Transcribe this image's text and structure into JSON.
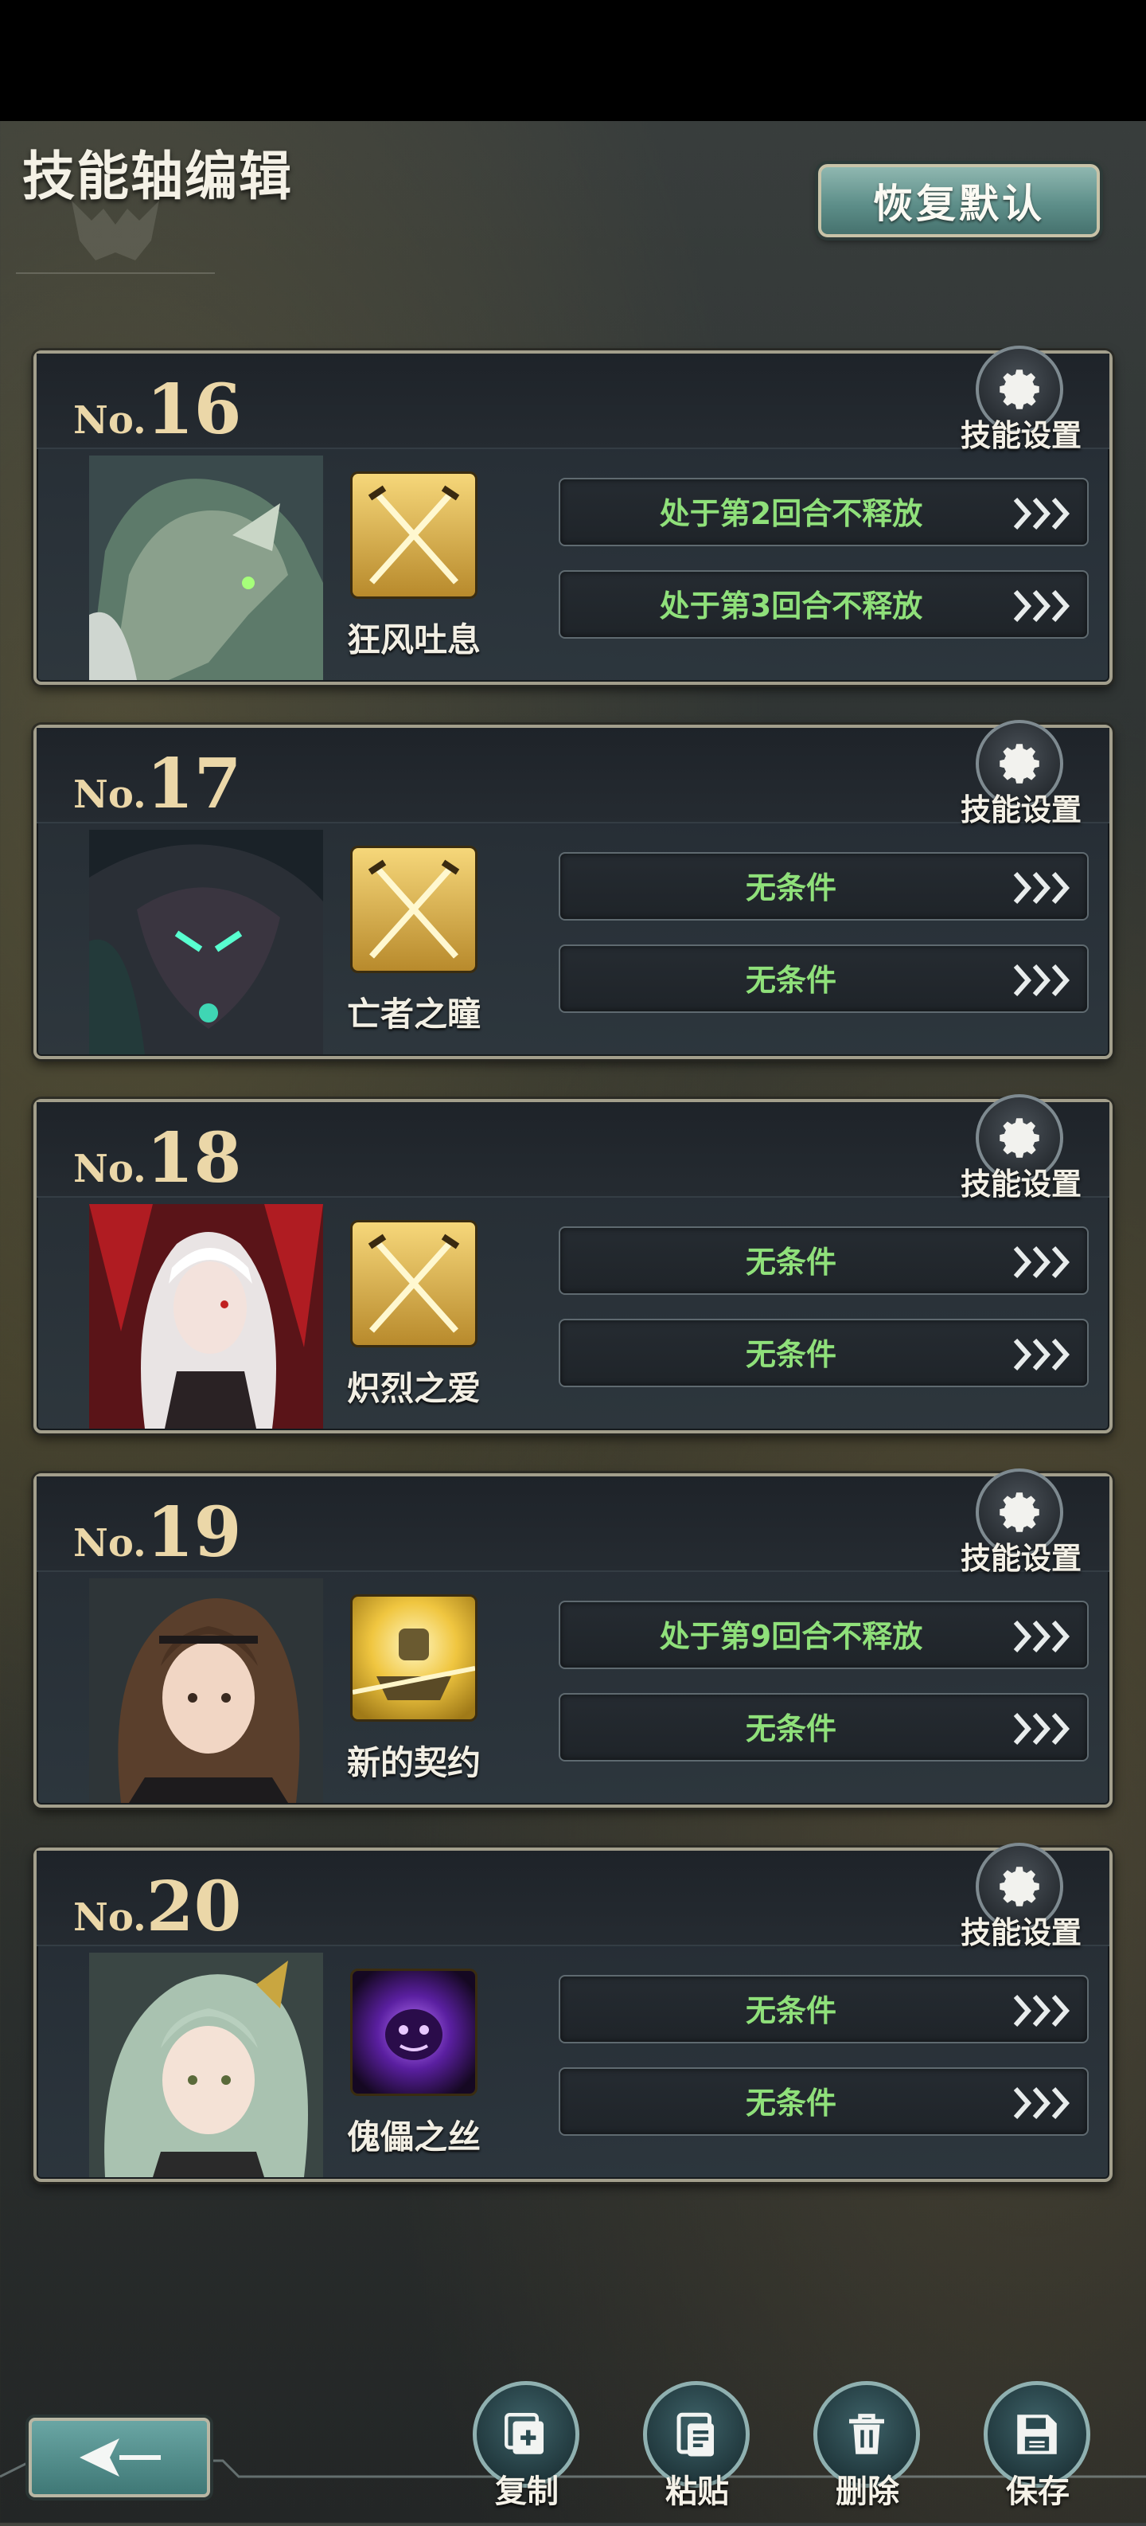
{
  "header": {
    "title": "技能轴编辑",
    "restore_button": "恢复默认"
  },
  "cards": [
    {
      "no_prefix": "No.",
      "no": "16",
      "settings_label": "技能设置",
      "skill_name": "狂风吐息",
      "skill_icon": "crossed-swords-icon",
      "conditions": [
        "处于第2回合不释放",
        "处于第3回合不释放"
      ]
    },
    {
      "no_prefix": "No.",
      "no": "17",
      "settings_label": "技能设置",
      "skill_name": "亡者之瞳",
      "skill_icon": "crossed-swords-icon",
      "conditions": [
        "无条件",
        "无条件"
      ]
    },
    {
      "no_prefix": "No.",
      "no": "18",
      "settings_label": "技能设置",
      "skill_name": "炽烈之爱",
      "skill_icon": "crossed-swords-icon",
      "conditions": [
        "无条件",
        "无条件"
      ]
    },
    {
      "no_prefix": "No.",
      "no": "19",
      "settings_label": "技能设置",
      "skill_name": "新的契约",
      "skill_icon": "golden-knight-icon",
      "conditions": [
        "处于第9回合不释放",
        "无条件"
      ]
    },
    {
      "no_prefix": "No.",
      "no": "20",
      "settings_label": "技能设置",
      "skill_name": "傀儡之丝",
      "skill_icon": "purple-spirit-icon",
      "conditions": [
        "无条件",
        "无条件"
      ]
    }
  ],
  "toolbar": {
    "copy": "复制",
    "paste": "粘贴",
    "delete": "删除",
    "save": "保存"
  },
  "colors": {
    "accent_teal": "#5e8f8a",
    "condition_green": "#8fe07a",
    "number_gold": "#ebd7a8"
  }
}
